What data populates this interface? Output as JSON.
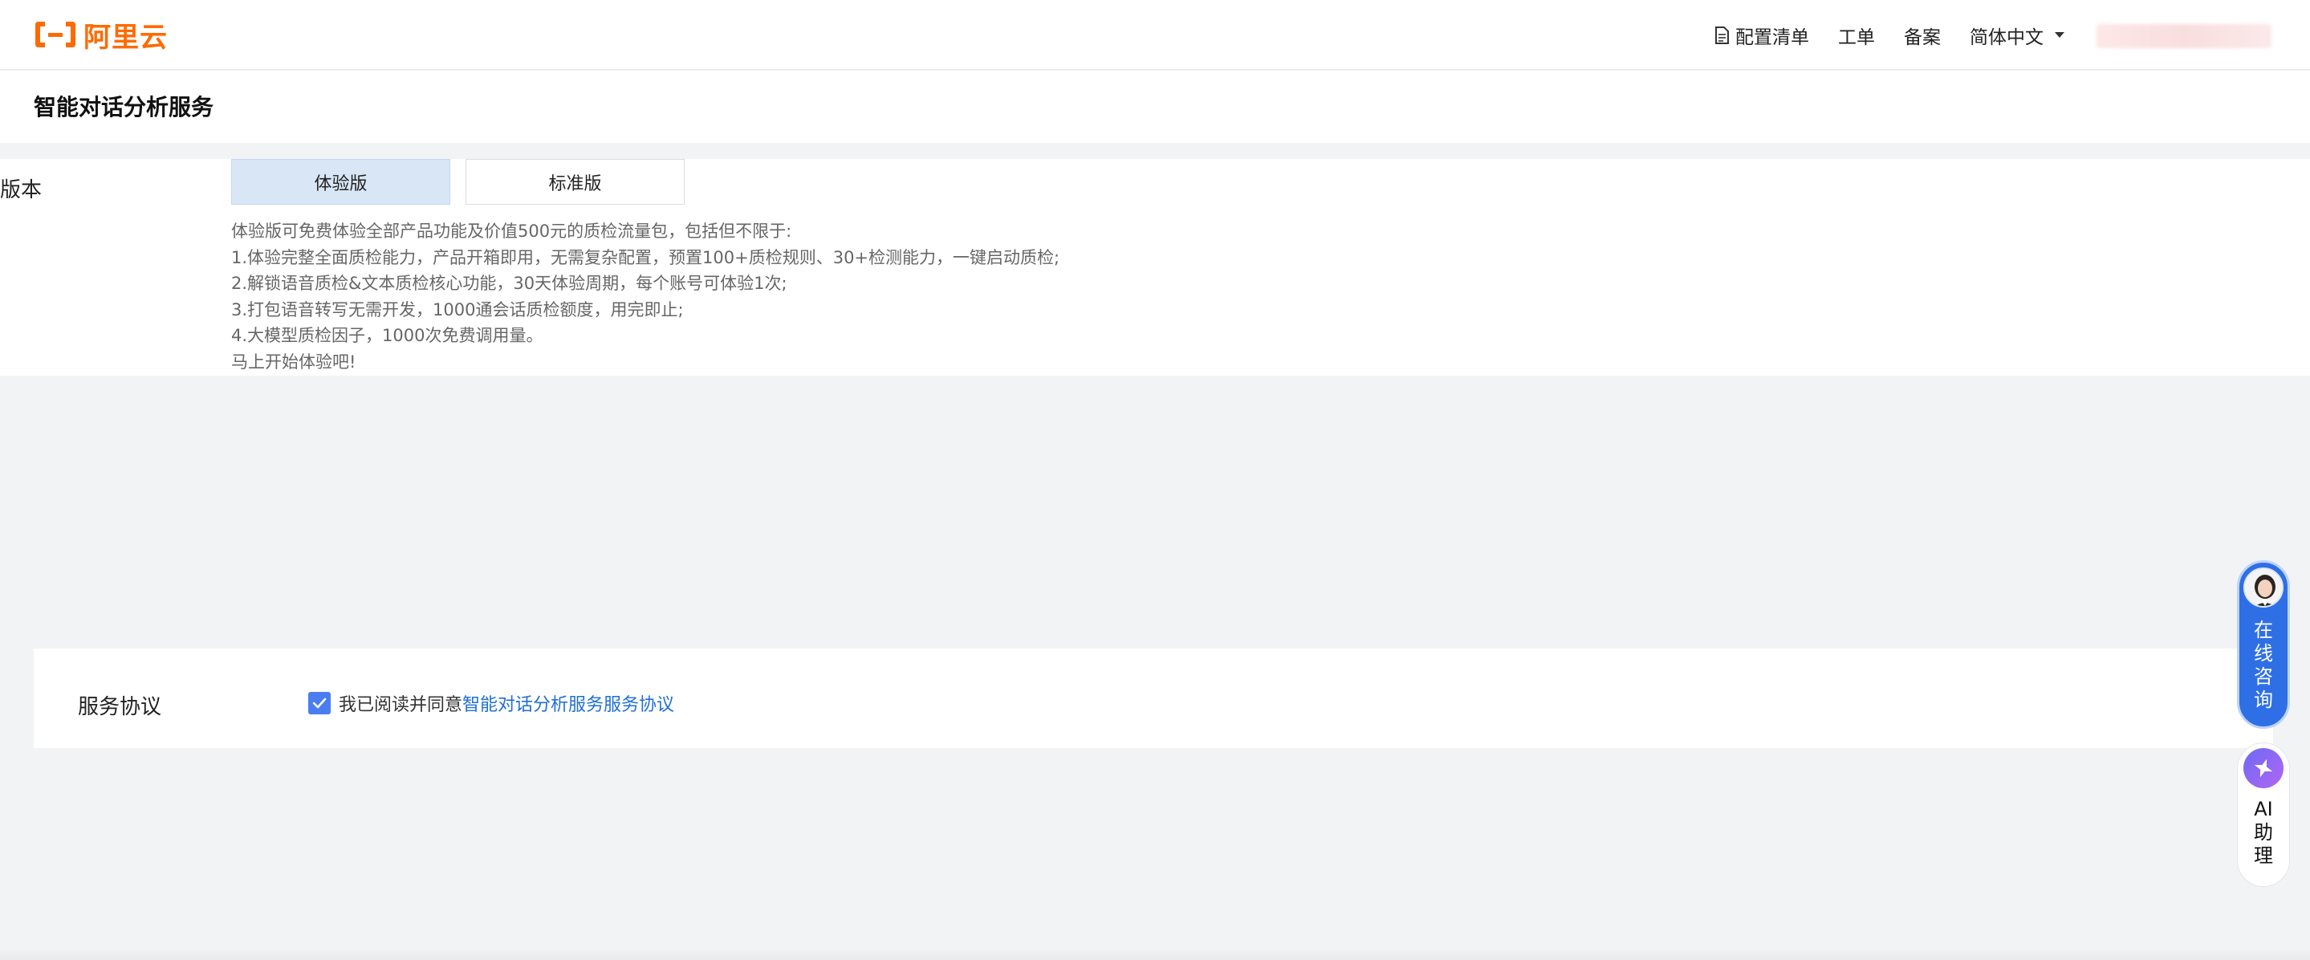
{
  "brand": {
    "logo_text": "阿里云",
    "accent": "#ff6a00"
  },
  "nav": {
    "items": [
      {
        "label": "配置清单",
        "icon": "document-icon"
      },
      {
        "label": "工单"
      },
      {
        "label": "备案"
      },
      {
        "label": "简体中文",
        "icon": "caret-down-icon"
      }
    ]
  },
  "page": {
    "title": "智能对话分析服务"
  },
  "version": {
    "label": "版本",
    "tabs": [
      {
        "label": "体验版",
        "active": true
      },
      {
        "label": "标准版",
        "active": false
      }
    ],
    "description": [
      "体验版可免费体验全部产品功能及价值500元的质检流量包，包括但不限于:",
      "1.体验完整全面质检能力，产品开箱即用，无需复杂配置，预置100+质检规则、30+检测能力，一键启动质检;",
      "2.解锁语音质检&文本质检核心功能，30天体验周期，每个账号可体验1次;",
      "3.打包语音转写无需开发，1000通会话质检额度，用完即止;",
      "4.大模型质检因子，1000次免费调用量。",
      "马上开始体验吧!"
    ]
  },
  "agreement": {
    "label": "服务协议",
    "checked": true,
    "text": "我已阅读并同意",
    "link": "智能对话分析服务服务协议",
    "link_color": "#1f6fd6"
  },
  "widgets": {
    "consult": {
      "label": "在线咨询",
      "color": "#2f6fe6"
    },
    "ai": {
      "label": "AI助理"
    }
  }
}
